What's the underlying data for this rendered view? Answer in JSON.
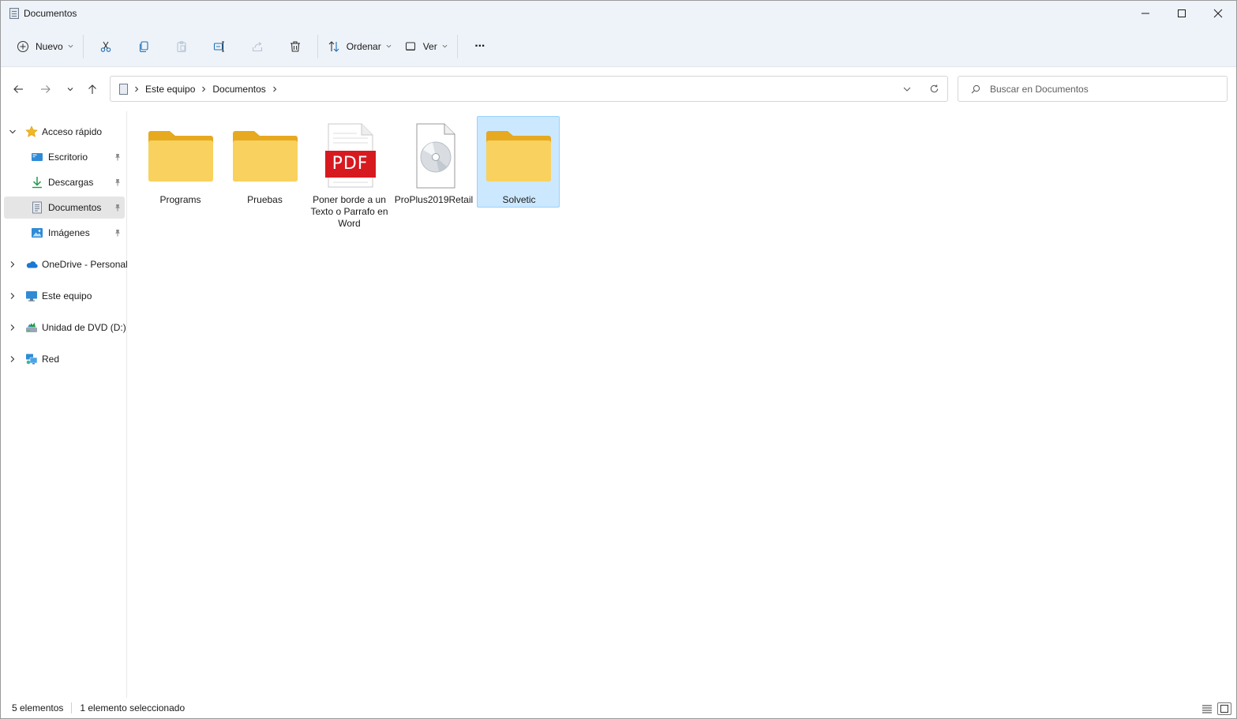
{
  "window": {
    "title": "Documentos"
  },
  "toolbar": {
    "new_label": "Nuevo",
    "sort_label": "Ordenar",
    "view_label": "Ver",
    "more_label": "···"
  },
  "address": {
    "crumbs": [
      "Este equipo",
      "Documentos"
    ]
  },
  "search": {
    "placeholder": "Buscar en Documentos"
  },
  "sidebar": {
    "quick_access": "Acceso rápido",
    "pinned": [
      {
        "label": "Escritorio",
        "icon": "desktop-icon"
      },
      {
        "label": "Descargas",
        "icon": "download-icon"
      },
      {
        "label": "Documentos",
        "icon": "documents-icon"
      },
      {
        "label": "Imágenes",
        "icon": "pictures-icon"
      }
    ],
    "sections": [
      {
        "label": "OneDrive - Personal",
        "icon": "onedrive-icon"
      },
      {
        "label": "Este equipo",
        "icon": "computer-icon"
      },
      {
        "label": "Unidad de DVD (D:)",
        "icon": "dvd-drive-icon"
      },
      {
        "label": "Red",
        "icon": "network-icon"
      }
    ]
  },
  "files": [
    {
      "name": "Programs",
      "type": "folder"
    },
    {
      "name": "Pruebas",
      "type": "folder"
    },
    {
      "name": "Poner borde a un Texto o Parrafo en Word",
      "type": "pdf",
      "badge": "PDF"
    },
    {
      "name": "ProPlus2019Retail",
      "type": "disc-image"
    },
    {
      "name": "Solvetic",
      "type": "folder",
      "selected": true
    }
  ],
  "status": {
    "count": "5 elementos",
    "selection": "1 elemento seleccionado"
  },
  "colors": {
    "selection_bg": "#cce8ff",
    "selection_border": "#99d1ff",
    "folder_yellow": "#f8cf5a",
    "pdf_red": "#d71920",
    "chrome_bg": "#eef3f9"
  }
}
